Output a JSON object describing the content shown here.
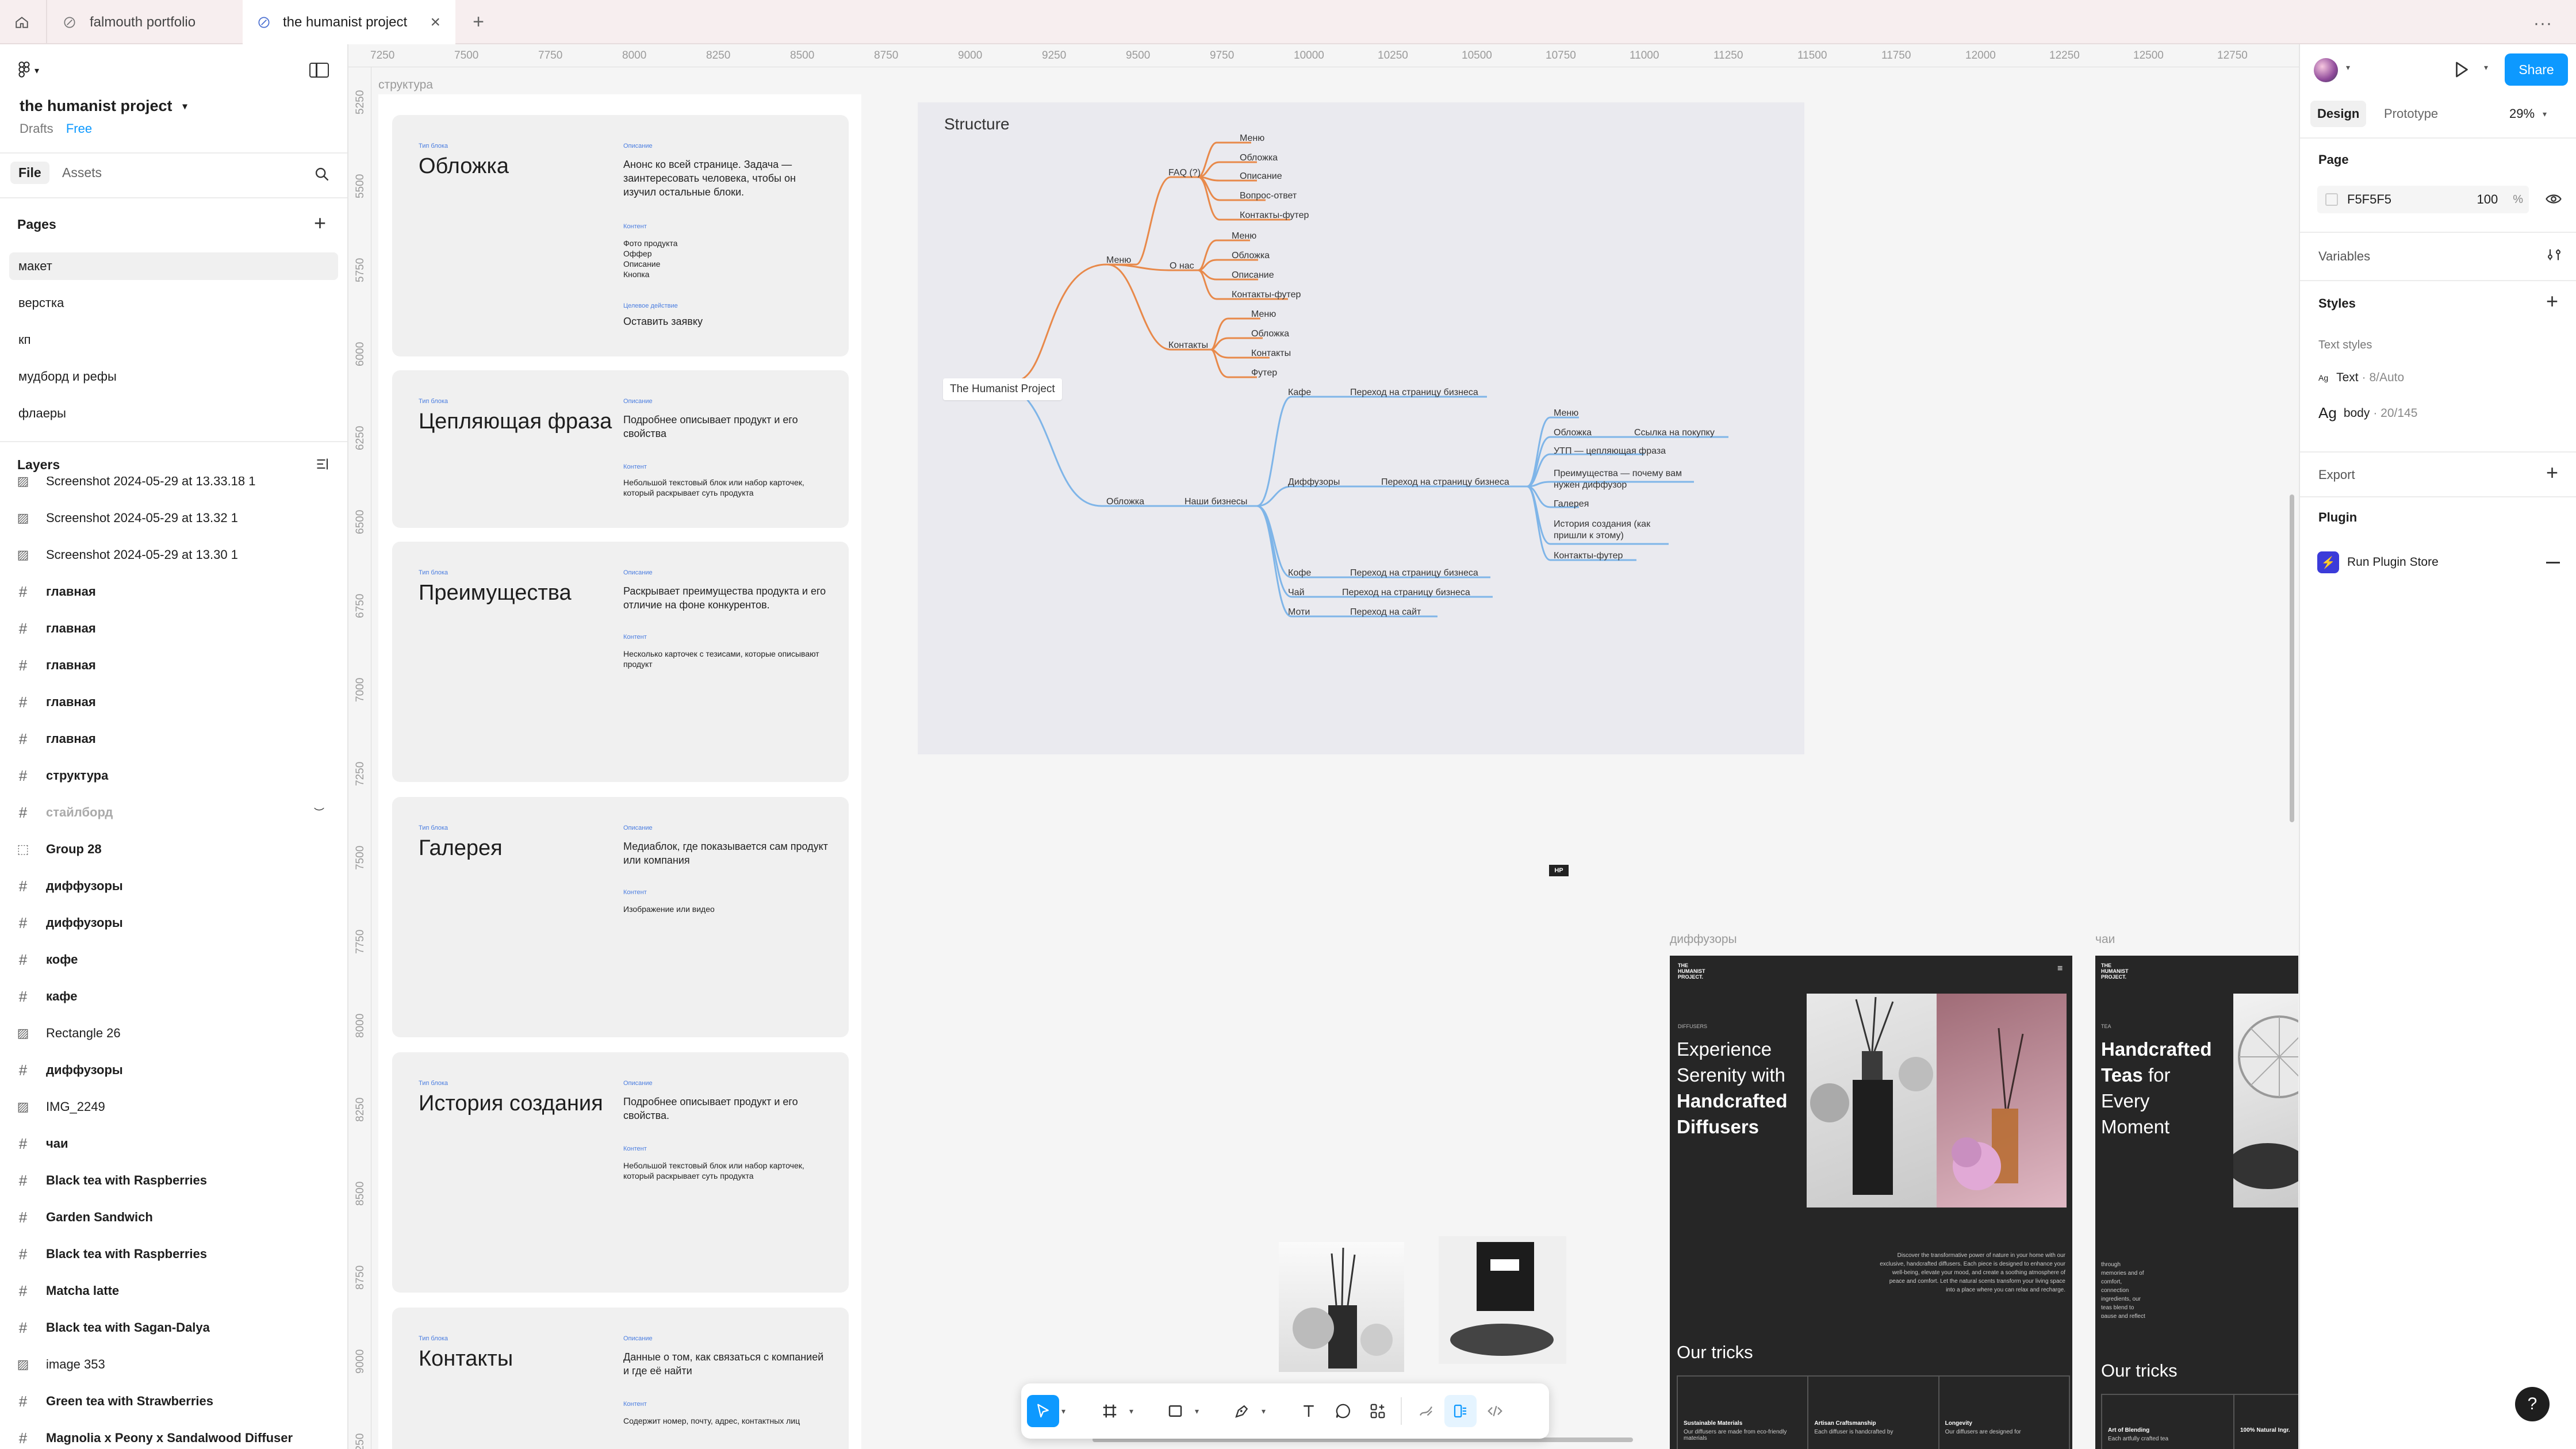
{
  "app": {
    "tabs": [
      {
        "label": "falmouth portfolio"
      },
      {
        "label": "the humanist project"
      }
    ]
  },
  "left": {
    "file_name": "the humanist project",
    "drafts": "Drafts",
    "plan": "Free",
    "tab_file": "File",
    "tab_assets": "Assets",
    "pages_title": "Pages",
    "pages": [
      "макет",
      "верстка",
      "кп",
      "мудборд и рефы",
      "флаеры"
    ],
    "layers_title": "Layers",
    "layers": [
      {
        "label": "Screenshot 2024-05-29 at 13.32 1",
        "kind": "image"
      },
      {
        "label": "Screenshot 2024-05-29 at 13.30 1",
        "kind": "image"
      },
      {
        "label": "главная",
        "kind": "frame"
      },
      {
        "label": "главная",
        "kind": "frame"
      },
      {
        "label": "главная",
        "kind": "frame"
      },
      {
        "label": "главная",
        "kind": "frame"
      },
      {
        "label": "главная",
        "kind": "frame"
      },
      {
        "label": "структура",
        "kind": "frame"
      },
      {
        "label": "стайлборд",
        "kind": "frame-hidden"
      },
      {
        "label": "Group 28",
        "kind": "group"
      },
      {
        "label": "диффузоры",
        "kind": "frame"
      },
      {
        "label": "диффузоры",
        "kind": "frame"
      },
      {
        "label": "кофе",
        "kind": "frame"
      },
      {
        "label": "кафе",
        "kind": "frame"
      },
      {
        "label": "Rectangle 26",
        "kind": "image"
      },
      {
        "label": "диффузоры",
        "kind": "frame"
      },
      {
        "label": "IMG_2249",
        "kind": "image"
      },
      {
        "label": "чаи",
        "kind": "frame"
      },
      {
        "label": "Black tea with Raspberries",
        "kind": "frame"
      },
      {
        "label": "Garden Sandwich",
        "kind": "frame"
      },
      {
        "label": "Black tea with Raspberries",
        "kind": "frame"
      },
      {
        "label": "Matcha latte",
        "kind": "frame"
      },
      {
        "label": "Black tea with Sagan-Dalya",
        "kind": "frame"
      },
      {
        "label": "image 353",
        "kind": "image"
      },
      {
        "label": "Green tea with Strawberries",
        "kind": "frame"
      },
      {
        "label": "Magnolia x Peony x Sandalwood Diffuser",
        "kind": "frame"
      }
    ]
  },
  "ruler": {
    "h": [
      "7250",
      "7500",
      "7750",
      "8000",
      "8250",
      "8500",
      "8750",
      "9000",
      "9250",
      "9500",
      "9750",
      "10000",
      "10250",
      "10500",
      "10750",
      "11000",
      "11250",
      "11500",
      "11750",
      "12000",
      "12250",
      "12500",
      "12750"
    ],
    "v": [
      "5250",
      "5500",
      "5750",
      "6000",
      "6250",
      "6500",
      "6750",
      "7000",
      "7250",
      "7500",
      "7750",
      "8000",
      "8250",
      "8500",
      "8750",
      "9000",
      "9250"
    ]
  },
  "canvas": {
    "frame_label_structure": "структура",
    "frame_label_diffusers": "диффузоры",
    "frame_label_teas": "чаи",
    "cards": [
      {
        "block": "Тип блока",
        "title": "Обложка",
        "obj_label": "Описание",
        "obj_desc": "Анонс ко всей странице. Задача — заинтересовать человека, чтобы он изучил остальные блоки.",
        "content_label": "Контент",
        "content_desc": "Фото продукта\nОффер\nОписание\nКнопка",
        "action_label": "Целевое действие",
        "action_desc": "Оставить заявку"
      },
      {
        "block": "Тип блока",
        "title": "Цепляющая фраза",
        "obj_label": "Описание",
        "obj_desc": "Подробнее описывает продукт и его свойства",
        "content_label": "Контент",
        "content_desc": "Небольшой текстовый блок или набор карточек, который раскрывает суть продукта"
      },
      {
        "block": "Тип блока",
        "title": "Преимущества",
        "obj_label": "Описание",
        "obj_desc": "Раскрывает преимущества продукта и его отличие на фоне конкурентов.",
        "content_label": "Контент",
        "content_desc": "Несколько карточек с тезисами, которые описывают продукт"
      },
      {
        "block": "Тип блока",
        "title": "Галерея",
        "obj_label": "Описание",
        "obj_desc": "Медиаблок, где показывается сам продукт или компания",
        "content_label": "Контент",
        "content_desc": "Изображение или видео"
      },
      {
        "block": "Тип блока",
        "title": "История создания",
        "obj_label": "Описание",
        "obj_desc": "Подробнее описывает продукт и его свойства.",
        "content_label": "Контент",
        "content_desc": "Небольшой текстовый блок или набор карточек, который раскрывает суть продукта"
      },
      {
        "block": "Тип блока",
        "title": "Контакты",
        "obj_label": "Описание",
        "obj_desc": "Данные о том, как связаться с компанией и где её найти",
        "content_label": "Контент",
        "content_desc": "Содержит номер, почту, адрес, контактных лиц"
      }
    ],
    "mindmap": {
      "title": "Structure",
      "root": "The Humanist Project",
      "menu": "Меню",
      "faq": "FAQ (?)",
      "about": "О нас",
      "contacts": "Контакты",
      "faq_items": [
        "Меню",
        "Обложка",
        "Описание",
        "Вопрос-ответ",
        "Контакты-футер"
      ],
      "about_items": [
        "Меню",
        "Обложка",
        "Описание",
        "Контакты-футер"
      ],
      "contacts_items": [
        "Меню",
        "Обложка",
        "Контакты",
        "Футер"
      ],
      "cover": "Обложка",
      "businesses": "Наши бизнесы",
      "cafe": "Кафе",
      "cafe_link": "Переход на страницу бизнеса",
      "diffusers": "Диффузоры",
      "diffusers_link": "Переход на страницу бизнеса",
      "diff_items": [
        "Меню",
        "Обложка",
        "УТП — цепляющая фраза",
        "Преимущества — почему вам нужен диффузор",
        "Галерея",
        "История создания (как пришли к этому)",
        "Контакты-футер"
      ],
      "buy_link": "Ссылка на покупку",
      "coffee": "Кофе",
      "coffee_link": "Переход на страницу бизнеса",
      "tea": "Чай",
      "tea_link": "Переход на страницу бизнеса",
      "moti": "Моти",
      "moti_link": "Переход на сайт"
    },
    "diffuser_frame": {
      "logo": "THE HUMANIST PROJECT.",
      "kicker": "DIFFUSERS",
      "headline_light1": "Experience",
      "headline_light2": "Serenity with",
      "headline_bold1": "Handcrafted",
      "headline_bold2": "Diffusers",
      "body": "Discover the transformative power of nature in your home with our exclusive, handcrafted diffusers. Each piece is designed to enhance your well-being, elevate your mood, and create a soothing atmosphere of peace and comfort. Let the natural scents transform your living space into a place where you can relax and recharge.",
      "tricks": "Our tricks",
      "cols": [
        {
          "h": "Sustainable Materials",
          "t": "Our diffusers are made from eco-friendly materials"
        },
        {
          "h": "Artisan Craftsmanship",
          "t": "Each diffuser is handcrafted by"
        },
        {
          "h": "Longevity",
          "t": "Our diffusers are designed for"
        }
      ]
    },
    "tea_frame": {
      "logo": "THE HUMANIST PROJECT.",
      "kicker": "TEA",
      "headline_bold1": "Handcrafted",
      "headline_bold2": "Teas",
      "headline_light": "for",
      "headline_light2": "Every",
      "headline_light3": "Moment",
      "body": "through memories and of comfort, connection ingredients, our teas blend to pause and reflect ensuring that each sip the simple joy of life",
      "tricks": "Our tricks",
      "cols": [
        {
          "h": "Art of Blending",
          "t": "Each artfully crafted tea"
        },
        {
          "h": "100% Natural Ingr.",
          "t": ""
        }
      ]
    },
    "hp_badge": "HP"
  },
  "right": {
    "tab_design": "Design",
    "tab_prototype": "Prototype",
    "zoom": "29%",
    "share": "Share",
    "page_title": "Page",
    "page_color": "F5F5F5",
    "page_opacity": "100",
    "pct": "%",
    "variables": "Variables",
    "styles": "Styles",
    "text_styles": "Text styles",
    "style1_name": "Text",
    "style1_meta": "· 8/Auto",
    "style2_name": "body",
    "style2_meta": "· 20/145",
    "export": "Export",
    "plugin": "Plugin",
    "plugin_item": "Run Plugin Store"
  },
  "help": "?",
  "colors": {
    "accent": "#0d99ff",
    "mind_orange": "#e8894a",
    "mind_blue": "#7fb5e8",
    "frame_dark": "#262626"
  }
}
